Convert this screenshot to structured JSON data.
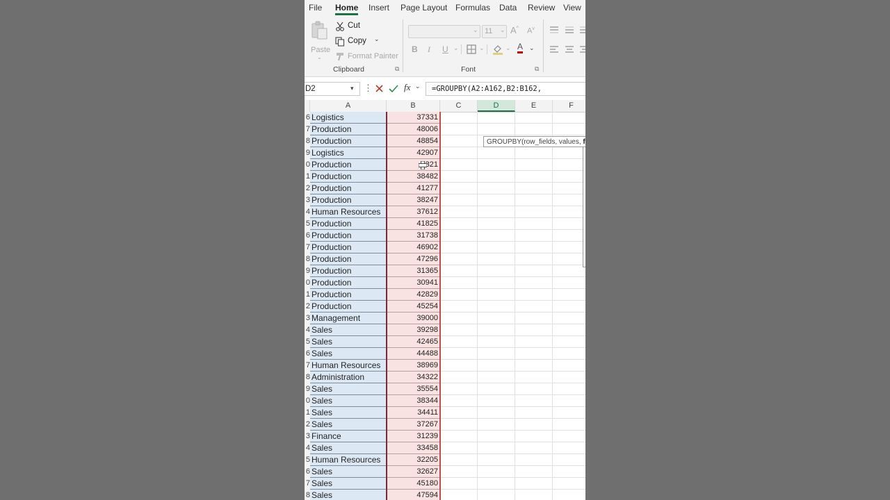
{
  "menu": {
    "items": [
      "File",
      "Home",
      "Insert",
      "Page Layout",
      "Formulas",
      "Data",
      "Review",
      "View"
    ],
    "active": "Home"
  },
  "ribbon": {
    "clipboard": {
      "paste_label": "Paste",
      "cut_label": "Cut",
      "copy_label": "Copy",
      "format_painter_label": "Format Painter",
      "group_label": "Clipboard"
    },
    "font": {
      "font_name": "",
      "font_size": "11",
      "bold_label": "B",
      "italic_label": "I",
      "underline_label": "U",
      "grow_label": "A",
      "shrink_label": "A",
      "font_color_label": "A",
      "group_label": "Font"
    }
  },
  "formula_bar": {
    "name_box": "D2",
    "fx_label": "fx",
    "formula": "=GROUPBY(A2:A162,B2:B162,"
  },
  "tooltip": {
    "text_start": "GROUPBY(row_fields, values, ",
    "text_bold": "fu"
  },
  "columns": [
    "A",
    "B",
    "C",
    "D",
    "E",
    "F"
  ],
  "selected_column": "D",
  "rows": [
    {
      "num": "6",
      "dept": "Logistics",
      "salary": "37331"
    },
    {
      "num": "7",
      "dept": "Production",
      "salary": "48006"
    },
    {
      "num": "8",
      "dept": "Production",
      "salary": "48854"
    },
    {
      "num": "9",
      "dept": "Logistics",
      "salary": "42907"
    },
    {
      "num": "0",
      "dept": "Production",
      "salary": "321"
    },
    {
      "num": "1",
      "dept": "Production",
      "salary": "38482"
    },
    {
      "num": "2",
      "dept": "Production",
      "salary": "41277"
    },
    {
      "num": "3",
      "dept": "Production",
      "salary": "38247"
    },
    {
      "num": "4",
      "dept": "Human Resources",
      "salary": "37612"
    },
    {
      "num": "5",
      "dept": "Production",
      "salary": "41825"
    },
    {
      "num": "6",
      "dept": "Production",
      "salary": "31738"
    },
    {
      "num": "7",
      "dept": "Production",
      "salary": "46902"
    },
    {
      "num": "8",
      "dept": "Production",
      "salary": "47296"
    },
    {
      "num": "9",
      "dept": "Production",
      "salary": "31365"
    },
    {
      "num": "0",
      "dept": "Production",
      "salary": "30941"
    },
    {
      "num": "1",
      "dept": "Production",
      "salary": "42829"
    },
    {
      "num": "2",
      "dept": "Production",
      "salary": "45254"
    },
    {
      "num": "3",
      "dept": "Management",
      "salary": "39000"
    },
    {
      "num": "4",
      "dept": "Sales",
      "salary": "39298"
    },
    {
      "num": "5",
      "dept": "Sales",
      "salary": "42465"
    },
    {
      "num": "6",
      "dept": "Sales",
      "salary": "44488"
    },
    {
      "num": "7",
      "dept": "Human Resources",
      "salary": "38969"
    },
    {
      "num": "8",
      "dept": "Administration",
      "salary": "34322"
    },
    {
      "num": "9",
      "dept": "Sales",
      "salary": "35554"
    },
    {
      "num": "0",
      "dept": "Sales",
      "salary": "38344"
    },
    {
      "num": "1",
      "dept": "Sales",
      "salary": "34411"
    },
    {
      "num": "2",
      "dept": "Sales",
      "salary": "37267"
    },
    {
      "num": "3",
      "dept": "Finance",
      "salary": "31239"
    },
    {
      "num": "4",
      "dept": "Sales",
      "salary": "33458"
    },
    {
      "num": "5",
      "dept": "Human Resources",
      "salary": "32205"
    },
    {
      "num": "6",
      "dept": "Sales",
      "salary": "32627"
    },
    {
      "num": "7",
      "dept": "Sales",
      "salary": "45180"
    },
    {
      "num": "8",
      "dept": "Sales",
      "salary": "47594"
    }
  ],
  "colors": {
    "accent": "#1e7145",
    "column_a_fill": "#dce9f5",
    "column_b_fill": "#f9e2e2",
    "column_b_border": "#c0504d"
  }
}
